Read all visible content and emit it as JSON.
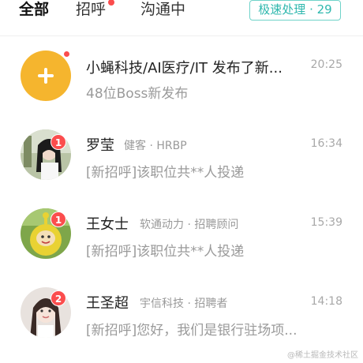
{
  "tabs": [
    {
      "label": "全部",
      "active": true
    },
    {
      "label": "招呼",
      "active": false,
      "has_dot": true
    },
    {
      "label": "沟通中",
      "active": false
    }
  ],
  "speed_button": {
    "label": "极速处理 · 29"
  },
  "colors": {
    "accent": "#2fb8ae",
    "badge": "#fb4d4d",
    "system_avatar": "#f5b52e"
  },
  "messages": [
    {
      "avatar": "plus-icon",
      "title": "小蝇科技/AI医疗/IT 发布了新...",
      "subtitle": "",
      "time": "20:25",
      "preview": "48位Boss新发布",
      "unread_dot": true
    },
    {
      "avatar": "person-photo",
      "title": "罗莹",
      "subtitle": "健客 · HRBP",
      "time": "16:34",
      "preview": "[新招呼]该职位共**人投递",
      "badge": "1"
    },
    {
      "avatar": "teletubby-photo",
      "title": "王女士",
      "subtitle": "软通动力 · 招聘顾问",
      "time": "15:39",
      "preview": "[新招呼]该职位共**人投递",
      "badge": "1"
    },
    {
      "avatar": "person-photo",
      "title": "王圣超",
      "subtitle": "宇信科技 · 招聘者",
      "time": "14:18",
      "preview": "[新招呼]您好，我们是银行驻场项...",
      "badge": "2"
    }
  ],
  "watermark": "@稀土掘金技术社区"
}
